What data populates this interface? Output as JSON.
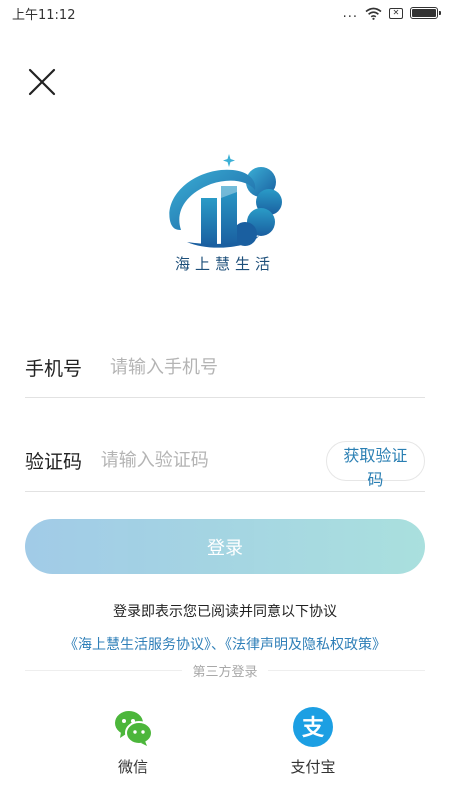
{
  "status_bar": {
    "time": "上午11:12",
    "signal_dots": "...",
    "sim_icon": "sim-x-icon",
    "wifi_icon": "wifi-icon",
    "battery_icon": "battery-icon"
  },
  "header": {
    "close_icon": "close-icon"
  },
  "logo": {
    "icon": "haishang-logo-icon",
    "brand_name": "海上慧生活",
    "colors": {
      "blue": "#1a5fa0",
      "teal": "#2a9bc7",
      "light": "#3bb0d6"
    }
  },
  "form": {
    "phone": {
      "label": "手机号",
      "placeholder": "请输入手机号",
      "value": ""
    },
    "code": {
      "label": "验证码",
      "placeholder": "请输入验证码",
      "value": "",
      "get_code_label": "获取验证码"
    },
    "login_label": "登录",
    "login_gradient": [
      "#9cc8e6",
      "#a5dedc"
    ]
  },
  "agreement": {
    "text": "登录即表示您已阅读并同意以下协议",
    "service_link": "《海上慧生活服务协议》",
    "separator": "、",
    "privacy_link": "《法律声明及隐私权政策》",
    "link_color": "#2f7fb8"
  },
  "third_party": {
    "title": "第三方登录",
    "wechat": {
      "label": "微信",
      "icon": "wechat-icon",
      "color": "#4cb63b"
    },
    "alipay": {
      "label": "支付宝",
      "icon": "alipay-icon",
      "color": "#1c9fe3"
    }
  }
}
